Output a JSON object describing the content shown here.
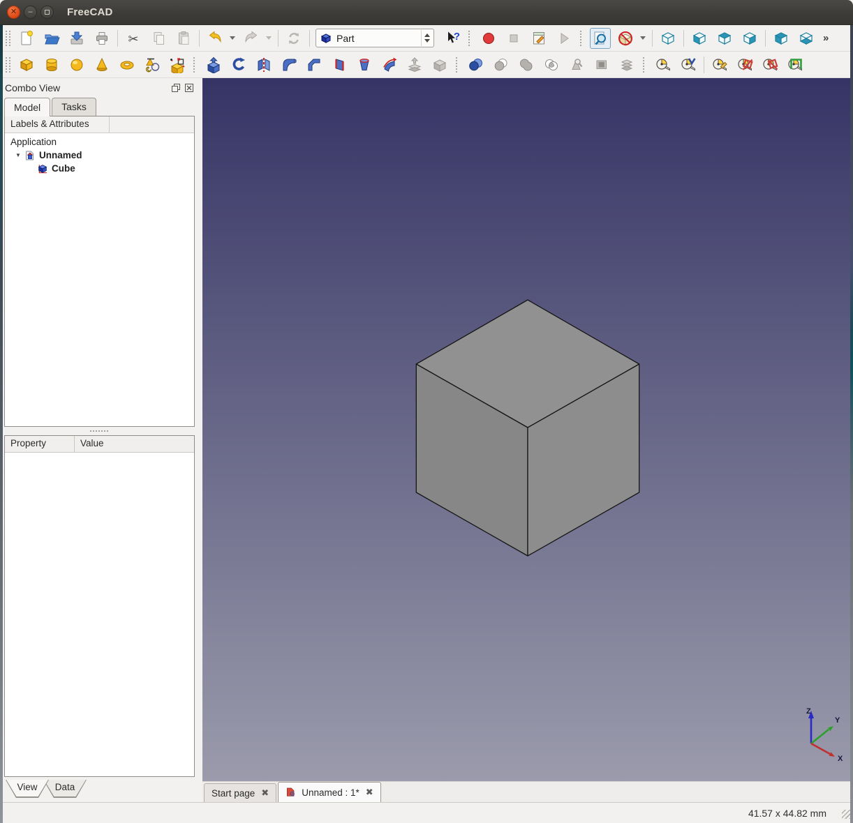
{
  "window": {
    "title": "FreeCAD",
    "controls": [
      "close",
      "minimize",
      "maximize"
    ]
  },
  "toolbars": {
    "row1": [
      {
        "type": "handle2"
      },
      {
        "type": "button",
        "name": "new-document",
        "icon": "new",
        "enabled": true
      },
      {
        "type": "button",
        "name": "open-document",
        "icon": "open",
        "enabled": true
      },
      {
        "type": "button",
        "name": "save-document",
        "icon": "save",
        "enabled": true
      },
      {
        "type": "button",
        "name": "print",
        "icon": "print",
        "enabled": true
      },
      {
        "type": "separator"
      },
      {
        "type": "button",
        "name": "cut",
        "icon": "cut",
        "enabled": true
      },
      {
        "type": "button",
        "name": "copy",
        "icon": "copy",
        "enabled": false
      },
      {
        "type": "button",
        "name": "paste",
        "icon": "paste",
        "enabled": false
      },
      {
        "type": "separator"
      },
      {
        "type": "button",
        "name": "undo",
        "icon": "undo",
        "enabled": true
      },
      {
        "type": "caret",
        "name": "undo-history",
        "enabled": true
      },
      {
        "type": "button",
        "name": "redo",
        "icon": "redo",
        "enabled": false
      },
      {
        "type": "caret",
        "name": "redo-history",
        "enabled": false
      },
      {
        "type": "separator"
      },
      {
        "type": "button",
        "name": "refresh",
        "icon": "refresh",
        "enabled": false
      },
      {
        "type": "separator"
      },
      {
        "type": "combo",
        "name": "workbench-selector",
        "icon": "wbcube",
        "value": "Part"
      },
      {
        "type": "button",
        "name": "whats-this",
        "icon": "whatsthis",
        "enabled": true
      },
      {
        "type": "handle"
      },
      {
        "type": "button",
        "name": "macro-record",
        "icon": "record",
        "enabled": true
      },
      {
        "type": "button",
        "name": "macro-stop",
        "icon": "stop",
        "enabled": false
      },
      {
        "type": "button",
        "name": "macro-edit",
        "icon": "macroedit",
        "enabled": true
      },
      {
        "type": "button",
        "name": "macro-play",
        "icon": "play",
        "enabled": false
      },
      {
        "type": "handle"
      },
      {
        "type": "button",
        "name": "fit-all",
        "icon": "fitall",
        "enabled": true,
        "checked": true
      },
      {
        "type": "button",
        "name": "draw-style",
        "icon": "drawstyle",
        "enabled": true
      },
      {
        "type": "caret",
        "name": "draw-style-options",
        "enabled": true
      },
      {
        "type": "separator"
      },
      {
        "type": "button",
        "name": "view-axonometric",
        "icon": "vaxo",
        "enabled": true
      },
      {
        "type": "separator"
      },
      {
        "type": "button",
        "name": "view-front",
        "icon": "vfront",
        "enabled": true
      },
      {
        "type": "button",
        "name": "view-top",
        "icon": "vtop",
        "enabled": true
      },
      {
        "type": "button",
        "name": "view-right",
        "icon": "vright",
        "enabled": true
      },
      {
        "type": "separator"
      },
      {
        "type": "button",
        "name": "view-rear",
        "icon": "vrear",
        "enabled": true
      },
      {
        "type": "button",
        "name": "view-left",
        "icon": "vleft",
        "enabled": true
      },
      {
        "type": "overflow",
        "name": "toolbar-overflow",
        "label": "»"
      }
    ],
    "row2": [
      {
        "type": "handle2"
      },
      {
        "type": "button",
        "name": "part-box",
        "icon": "ybox",
        "enabled": true
      },
      {
        "type": "button",
        "name": "part-cylinder",
        "icon": "ycyl",
        "enabled": true
      },
      {
        "type": "button",
        "name": "part-sphere",
        "icon": "ysph",
        "enabled": true
      },
      {
        "type": "button",
        "name": "part-cone",
        "icon": "ycone",
        "enabled": true
      },
      {
        "type": "button",
        "name": "part-torus",
        "icon": "ytorus",
        "enabled": true
      },
      {
        "type": "button",
        "name": "part-primitives",
        "icon": "yprim",
        "enabled": true
      },
      {
        "type": "button",
        "name": "shape-builder",
        "icon": "ybuilder",
        "enabled": true
      },
      {
        "type": "handle"
      },
      {
        "type": "button",
        "name": "extrude",
        "icon": "extrude",
        "enabled": true
      },
      {
        "type": "button",
        "name": "revolve",
        "icon": "revolve",
        "enabled": true
      },
      {
        "type": "button",
        "name": "mirror",
        "icon": "mirror",
        "enabled": true
      },
      {
        "type": "button",
        "name": "fillet",
        "icon": "fillet",
        "enabled": true
      },
      {
        "type": "button",
        "name": "chamfer",
        "icon": "chamfer",
        "enabled": true
      },
      {
        "type": "button",
        "name": "ruled-surface",
        "icon": "ruled",
        "enabled": true
      },
      {
        "type": "button",
        "name": "loft",
        "icon": "loft",
        "enabled": true
      },
      {
        "type": "button",
        "name": "sweep",
        "icon": "sweep",
        "enabled": true
      },
      {
        "type": "button",
        "name": "offset",
        "icon": "offset",
        "enabled": false
      },
      {
        "type": "button",
        "name": "thickness",
        "icon": "thickness",
        "enabled": false
      },
      {
        "type": "handle"
      },
      {
        "type": "button",
        "name": "boolean",
        "icon": "boolean",
        "enabled": true
      },
      {
        "type": "button",
        "name": "boolean-cut",
        "icon": "bcut",
        "enabled": false
      },
      {
        "type": "button",
        "name": "boolean-union",
        "icon": "bunion",
        "enabled": false
      },
      {
        "type": "button",
        "name": "boolean-intersection",
        "icon": "binter",
        "enabled": false
      },
      {
        "type": "button",
        "name": "check-geometry",
        "icon": "checkgeo",
        "enabled": false
      },
      {
        "type": "button",
        "name": "section",
        "icon": "section",
        "enabled": false
      },
      {
        "type": "button",
        "name": "cross-sections",
        "icon": "xsections",
        "enabled": false
      },
      {
        "type": "handle"
      },
      {
        "type": "button",
        "name": "measure-linear",
        "icon": "mlinear",
        "enabled": true
      },
      {
        "type": "button",
        "name": "measure-angular",
        "icon": "mangular",
        "enabled": true
      },
      {
        "type": "separator"
      },
      {
        "type": "button",
        "name": "measure-refresh",
        "icon": "mrefresh",
        "enabled": true
      },
      {
        "type": "button",
        "name": "measure-clear-all",
        "icon": "mclear",
        "enabled": true
      },
      {
        "type": "button",
        "name": "measure-toggle-all",
        "icon": "mtoggle",
        "enabled": true
      },
      {
        "type": "button",
        "name": "measure-toggle-3d",
        "icon": "m3d",
        "enabled": true
      }
    ]
  },
  "combo_view": {
    "title": "Combo View",
    "window_buttons": [
      "float",
      "close"
    ],
    "tabs": [
      {
        "label": "Model",
        "active": true
      },
      {
        "label": "Tasks",
        "active": false
      }
    ],
    "tree_header": "Labels & Attributes",
    "tree": [
      {
        "label": "Application",
        "level": 0,
        "bold": false,
        "icon": null,
        "expander": null
      },
      {
        "label": "Unnamed",
        "level": 1,
        "bold": true,
        "icon": "docicon",
        "expander": "open"
      },
      {
        "label": "Cube",
        "level": 2,
        "bold": true,
        "icon": "cubeicon",
        "expander": null
      }
    ],
    "property_table": {
      "columns": [
        "Property",
        "Value"
      ],
      "rows": []
    },
    "bottom_tabs": [
      {
        "label": "View",
        "active": true
      },
      {
        "label": "Data",
        "active": false
      }
    ]
  },
  "viewport": {
    "scene": "gray cube shown in isometric view",
    "background_top": "#363465",
    "background_bottom": "#9B9BAC",
    "cube_face_colors": {
      "top": "#919191",
      "left": "#878787",
      "right": "#8D8D8D"
    },
    "cube_edge_color": "#161616",
    "axis_indicator": {
      "labels": {
        "x": "X",
        "y": "Y",
        "z": "Z"
      },
      "colors": {
        "x": "#c03030",
        "y": "#2aa02a",
        "z": "#2a2ac8"
      }
    }
  },
  "mdi_tabs": [
    {
      "label": "Start page",
      "icon": null,
      "active": false,
      "close": "✖"
    },
    {
      "label": "Unnamed : 1*",
      "icon": "fcicon",
      "active": true,
      "close": "✖"
    }
  ],
  "status_bar": {
    "dimensions": "41.57 x 44.82 mm"
  }
}
